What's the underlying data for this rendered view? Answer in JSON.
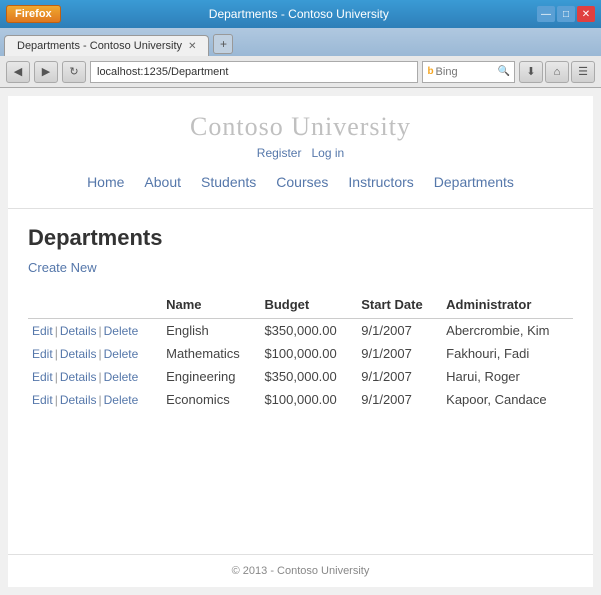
{
  "window": {
    "firefox_label": "Firefox",
    "title": "Departments - Contoso University",
    "minimize": "—",
    "maximize": "□",
    "close": "✕",
    "new_tab": "+"
  },
  "address_bar": {
    "back": "◀",
    "forward": "▶",
    "refresh": "↻",
    "url": "localhost:1235/Department",
    "search_placeholder": "Bing",
    "down_arrow": "▼",
    "download": "⬇",
    "home": "⌂",
    "menu": "☰"
  },
  "site": {
    "title": "Contoso University",
    "auth": {
      "register": "Register",
      "login": "Log in"
    },
    "nav": {
      "home": "Home",
      "about": "About",
      "students": "Students",
      "courses": "Courses",
      "instructors": "Instructors",
      "departments": "Departments"
    }
  },
  "page": {
    "heading": "Departments",
    "create_new": "Create New",
    "table": {
      "columns": [
        "Name",
        "Budget",
        "Start Date",
        "Administrator"
      ],
      "rows": [
        {
          "name": "English",
          "budget": "$350,000.00",
          "start_date": "9/1/2007",
          "administrator": "Abercrombie, Kim"
        },
        {
          "name": "Mathematics",
          "budget": "$100,000.00",
          "start_date": "9/1/2007",
          "administrator": "Fakhouri, Fadi"
        },
        {
          "name": "Engineering",
          "budget": "$350,000.00",
          "start_date": "9/1/2007",
          "administrator": "Harui, Roger"
        },
        {
          "name": "Economics",
          "budget": "$100,000.00",
          "start_date": "9/1/2007",
          "administrator": "Kapoor, Candace"
        }
      ],
      "actions": {
        "edit": "Edit",
        "details": "Details",
        "delete": "Delete"
      }
    }
  },
  "footer": {
    "text": "© 2013 - Contoso University"
  }
}
